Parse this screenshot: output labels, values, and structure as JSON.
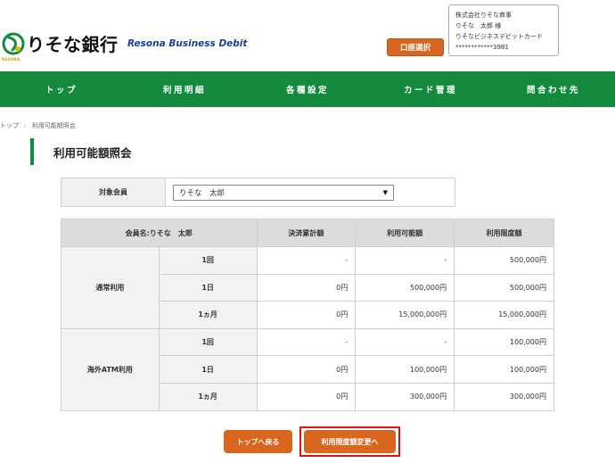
{
  "header": {
    "bank_name": "りそな銀行",
    "logo_sub": "RESONA",
    "product_name": "Resona Business Debit",
    "account_select_label": "口座選択",
    "user_box": {
      "company": "株式会社りそな商事",
      "user": "りそな　太郎 様",
      "card_name": "りそなビジネスデビットカード",
      "card_number": "************3981"
    }
  },
  "nav": {
    "items": [
      {
        "label": "トップ"
      },
      {
        "label": "利用明細"
      },
      {
        "label": "各種設定"
      },
      {
        "label": "カード管理"
      },
      {
        "label": "問合わせ先"
      }
    ]
  },
  "breadcrumb": {
    "home": "トップ",
    "separator": "›",
    "current": "利用可能額照会"
  },
  "page": {
    "title": "利用可能額照会"
  },
  "member_filter": {
    "label": "対象会員",
    "selected": "りそな　太郎"
  },
  "limits": {
    "headers": {
      "member": "会員名:りそな　太郎",
      "settled": "決済累計額",
      "available": "利用可能額",
      "limit": "利用限度額"
    },
    "groups": [
      {
        "name": "通常利用",
        "rows": [
          {
            "period": "1回",
            "settled": "-",
            "available": "-",
            "limit": "500,000円"
          },
          {
            "period": "1日",
            "settled": "0円",
            "available": "500,000円",
            "limit": "500,000円"
          },
          {
            "period": "1ヵ月",
            "settled": "0円",
            "available": "15,000,000円",
            "limit": "15,000,000円"
          }
        ]
      },
      {
        "name": "海外ATM利用",
        "rows": [
          {
            "period": "1回",
            "settled": "-",
            "available": "-",
            "limit": "100,000円"
          },
          {
            "period": "1日",
            "settled": "0円",
            "available": "100,000円",
            "limit": "100,000円"
          },
          {
            "period": "1ヵ月",
            "settled": "0円",
            "available": "300,000円",
            "limit": "300,000円"
          }
        ]
      }
    ]
  },
  "actions": {
    "back_to_top": "トップへ戻る",
    "change_limit": "利用限度額変更へ"
  },
  "colors": {
    "brand_green": "#138a3e",
    "button_orange": "#d9661f",
    "highlight_red": "#e01010"
  }
}
